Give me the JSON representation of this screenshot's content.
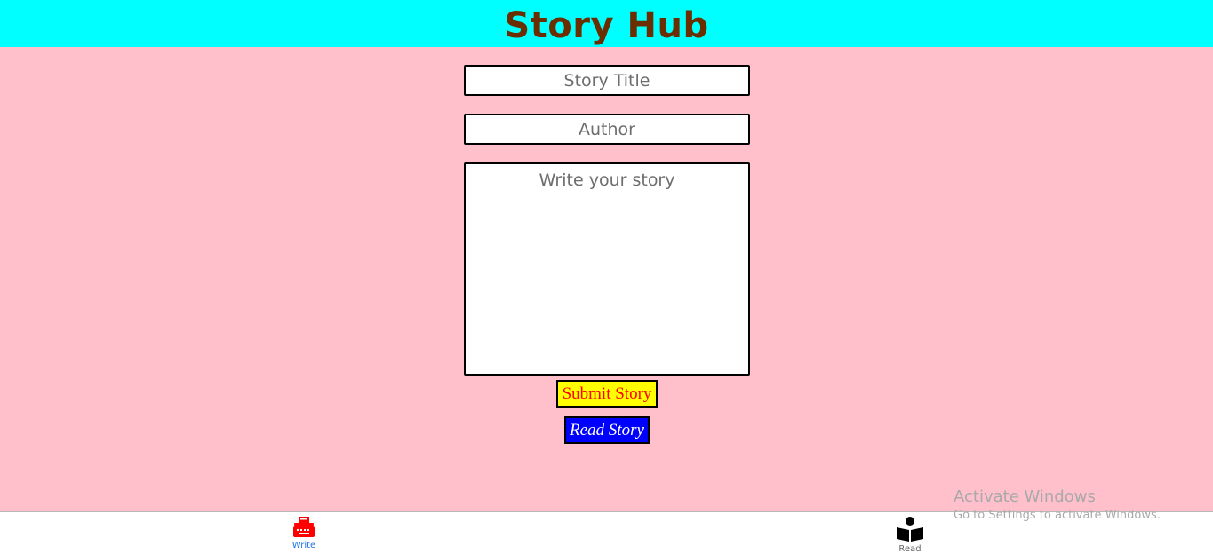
{
  "header": {
    "title": "Story Hub"
  },
  "form": {
    "title_placeholder": "Story Title",
    "author_placeholder": "Author",
    "story_placeholder": "Write your story",
    "submit_label": "Submit Story",
    "read_label": "Read Story"
  },
  "tabs": [
    {
      "label": "Write",
      "icon": "typewriter-icon",
      "active": true
    },
    {
      "label": "Read",
      "icon": "reader-icon",
      "active": false
    }
  ],
  "watermark": {
    "title": "Activate Windows",
    "subtitle": "Go to Settings to activate Windows."
  },
  "colors": {
    "background": "#ffc0cb",
    "header_bg": "#00ffff",
    "title_color": "#6b2e00",
    "submit_bg": "#ffff00",
    "submit_text": "#ff0000",
    "read_bg": "#0000ff",
    "read_text": "#ffffff",
    "active_icon": "#ff0000",
    "active_label": "#1a73e8"
  }
}
